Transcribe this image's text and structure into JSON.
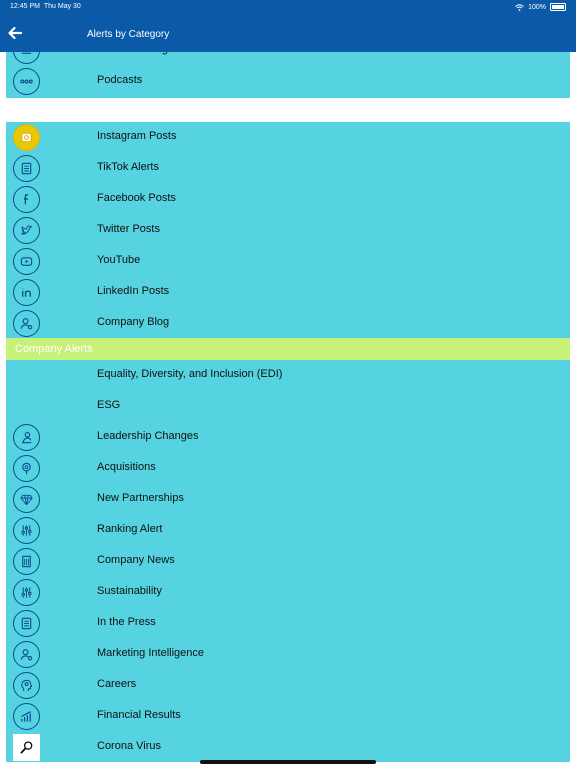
{
  "status": {
    "time": "12:45 PM",
    "date": "Thu May 30",
    "battery": "100%"
  },
  "nav": {
    "title": "Alerts by Category"
  },
  "colors": {
    "nav": "#0a5aa8",
    "list": "#56d3e0",
    "section": "#c8f17a",
    "icon_stroke": "#0b4b91"
  },
  "top_items": [
    {
      "label": "Banner Change",
      "icon": "list-icon"
    },
    {
      "label": "Podcasts",
      "icon": "more-dots-icon"
    }
  ],
  "social_items": [
    {
      "label": "Instagram Posts",
      "icon": "instagram-icon"
    },
    {
      "label": "TikTok Alerts",
      "icon": "document-icon"
    },
    {
      "label": "Facebook Posts",
      "icon": "facebook-icon"
    },
    {
      "label": "Twitter Posts",
      "icon": "twitter-icon"
    },
    {
      "label": "YouTube",
      "icon": "youtube-icon"
    },
    {
      "label": "LinkedIn Posts",
      "icon": "linkedin-icon"
    },
    {
      "label": "Company Blog",
      "icon": "user-gear-icon"
    }
  ],
  "company_section": {
    "title": "Company Alerts"
  },
  "company_items": [
    {
      "label": "Equality, Diversity, and Inclusion (EDI)",
      "icon": ""
    },
    {
      "label": "ESG",
      "icon": ""
    },
    {
      "label": "Leadership Changes",
      "icon": "leader-icon"
    },
    {
      "label": "Acquisitions",
      "icon": "target-icon"
    },
    {
      "label": "New Partnerships",
      "icon": "diamond-icon"
    },
    {
      "label": "Ranking Alert",
      "icon": "sliders-icon"
    },
    {
      "label": "Company News",
      "icon": "building-icon"
    },
    {
      "label": "Sustainability",
      "icon": "sliders-icon"
    },
    {
      "label": "In the Press",
      "icon": "document-icon"
    },
    {
      "label": "Marketing Intelligence",
      "icon": "user-gear-icon"
    },
    {
      "label": "Careers",
      "icon": "head-bulb-icon"
    },
    {
      "label": "Financial Results",
      "icon": "bar-chart-icon"
    },
    {
      "label": "Corona Virus",
      "icon": "magnifier-icon"
    }
  ]
}
